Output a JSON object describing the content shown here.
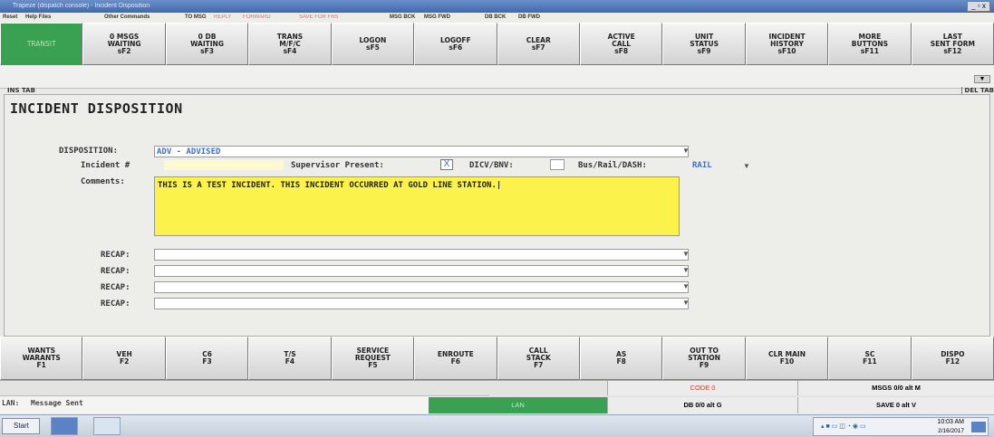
{
  "window": {
    "title": "Trapeze (dispatch console) - Incident Disposition",
    "controls": "_ ▫ x"
  },
  "menubar": [
    "Reset",
    "Help Files",
    "Other Commands",
    "TO MSG",
    "REPLY",
    "FORWARD",
    "SAVE FOR FRS",
    "MSG BCK",
    "MSG FWD",
    "DB BCK",
    "DB FWD"
  ],
  "top_fkeys": [
    {
      "l1": "TRANSIT",
      "l2": "",
      "l3": "",
      "active": true
    },
    {
      "l1": "0 MSGS",
      "l2": "WAITING",
      "l3": "sF2",
      "active": false
    },
    {
      "l1": "0 DB",
      "l2": "WAITING",
      "l3": "sF3",
      "active": false
    },
    {
      "l1": "TRANS",
      "l2": "M/F/C",
      "l3": "sF4",
      "active": false
    },
    {
      "l1": "LOGON",
      "l2": "sF5",
      "l3": "",
      "active": false
    },
    {
      "l1": "LOGOFF",
      "l2": "sF6",
      "l3": "",
      "active": false
    },
    {
      "l1": "CLEAR",
      "l2": "sF7",
      "l3": "",
      "active": false
    },
    {
      "l1": "ACTIVE",
      "l2": "CALL",
      "l3": "sF8",
      "active": false
    },
    {
      "l1": "UNIT",
      "l2": "STATUS",
      "l3": "sF9",
      "active": false
    },
    {
      "l1": "INCIDENT",
      "l2": "HISTORY",
      "l3": "sF10",
      "active": false
    },
    {
      "l1": "MORE",
      "l2": "BUTTONS",
      "l3": "sF11",
      "active": false
    },
    {
      "l1": "LAST",
      "l2": "SENT FORM",
      "l3": "sF12",
      "active": false
    }
  ],
  "tabs": {
    "ins": "INS TAB",
    "del": "DEL TAB"
  },
  "page_title": "INCIDENT DISPOSITION",
  "form": {
    "disposition_label": "DISPOSITION:",
    "disposition_value": "ADV - ADVISED",
    "incident_label": "Incident #",
    "supervisor_label": "Supervisor Present:",
    "supervisor_checked": "X",
    "dicv_label": "DICV/BNV:",
    "busrail_label": "Bus/Rail/DASH:",
    "busrail_value": "RAIL",
    "comments_label": "Comments:",
    "comments_value": "THIS IS A TEST INCIDENT.  THIS INCIDENT OCCURRED AT GOLD LINE STATION.|",
    "recap_label": "RECAP:"
  },
  "bottom_fkeys": [
    {
      "l1": "WANTS",
      "l2": "WARANTS",
      "l3": "F1"
    },
    {
      "l1": "VEH",
      "l2": "F2",
      "l3": ""
    },
    {
      "l1": "C6",
      "l2": "F3",
      "l3": ""
    },
    {
      "l1": "T/S",
      "l2": "F4",
      "l3": ""
    },
    {
      "l1": "SERVICE",
      "l2": "REQUEST",
      "l3": "F5"
    },
    {
      "l1": "ENROUTE",
      "l2": "F6",
      "l3": ""
    },
    {
      "l1": "CALL",
      "l2": "STACK",
      "l3": "F7"
    },
    {
      "l1": "AS",
      "l2": "F8",
      "l3": ""
    },
    {
      "l1": "OUT TO",
      "l2": "STATION",
      "l3": "F9"
    },
    {
      "l1": "CLR MAIN",
      "l2": "F10",
      "l3": ""
    },
    {
      "l1": "SC",
      "l2": "F11",
      "l3": ""
    },
    {
      "l1": "DISPO",
      "l2": "F12",
      "l3": ""
    }
  ],
  "status": {
    "code": "CODE 0",
    "msgs": "MSGS 0/0 alt M",
    "lan_label": "LAN:",
    "message": "Message Sent",
    "lan_indicator": "LAN",
    "db": "DB 0/0 alt G",
    "save": "SAVE 0 alt V"
  },
  "taskbar": {
    "start": "Start",
    "time": "10:03 AM",
    "date": "2/16/2017"
  },
  "colors": {
    "active_key": "#3aa152",
    "comments_bg": "#fbf34c",
    "link_blue": "#3b6fd4",
    "code_red": "#d23b2a"
  }
}
